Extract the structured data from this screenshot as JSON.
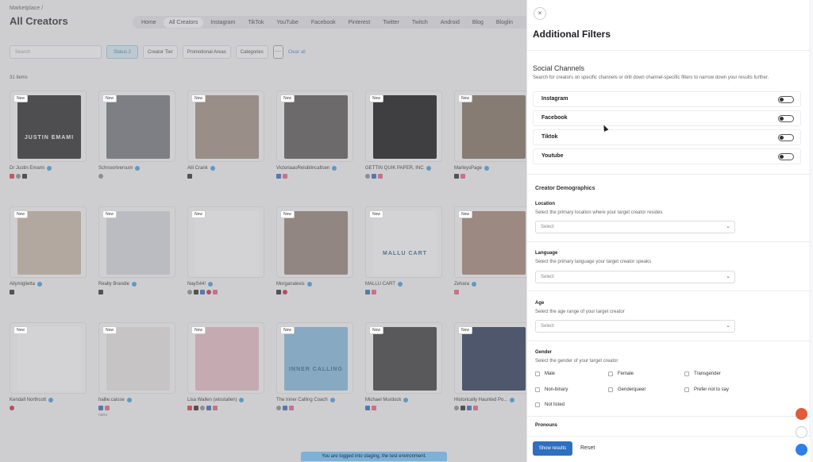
{
  "header": {
    "breadcrumb": "Marketplace /",
    "title": "All Creators",
    "nav": [
      "Home",
      "All Creators",
      "Instagram",
      "TikTok",
      "YouTube",
      "Facebook",
      "Pinterest",
      "Twitter",
      "Twitch",
      "Android",
      "Blog",
      "Bloglin"
    ]
  },
  "filters": {
    "search_placeholder": "Search",
    "status": "Status 2",
    "creator_tier": "Creator Tier",
    "promotional_areas": "Promotional Areas",
    "categories": "Categories",
    "more": "···",
    "clear_all": "Clear all",
    "items_count": "31 items"
  },
  "creators": [
    {
      "name": "Dr Justin Emami",
      "badge": "New",
      "socials": [
        "yt",
        "th",
        "tt"
      ],
      "thumb_text": "JUSTIN EMAMI"
    },
    {
      "name": "Schnoorlversum",
      "badge": "New",
      "socials": [
        "th"
      ]
    },
    {
      "name": "Alli Crank",
      "badge": "New",
      "socials": [
        "tt"
      ]
    },
    {
      "name": "VictoriaaoRelublincaltsen",
      "badge": "New",
      "socials": [
        "fb",
        "ig"
      ]
    },
    {
      "name": "GETTIN QUIK PAPER, INC",
      "badge": "New",
      "socials": [
        "th",
        "fb",
        "ig"
      ]
    },
    {
      "name": "MarleysPage",
      "badge": "New",
      "socials": [
        "tt",
        "ig"
      ]
    },
    {
      "name": "Allymiglietta",
      "badge": "New",
      "socials": [
        "tt"
      ]
    },
    {
      "name": "Really Brandie",
      "badge": "New",
      "socials": [
        "tt"
      ]
    },
    {
      "name": "NayS44!",
      "badge": "New",
      "socials": [
        "th",
        "tt",
        "fb",
        "pi",
        "ig"
      ]
    },
    {
      "name": "Morganalexis",
      "badge": "New",
      "socials": [
        "tt",
        "pi"
      ]
    },
    {
      "name": "MALLU CART",
      "badge": "New",
      "socials": [
        "fb",
        "ig"
      ],
      "thumb_text": "MALLU CART"
    },
    {
      "name": "Zehara",
      "badge": "New",
      "socials": [
        "ig"
      ]
    },
    {
      "name": "Kendall Northcott",
      "badge": "New",
      "socials": [
        "pi"
      ]
    },
    {
      "name": "hallie.caisse",
      "badge": "New",
      "socials": [
        "fb",
        "ig"
      ],
      "caption": "nanu"
    },
    {
      "name": "Lisa Wallen (wisstallen)",
      "badge": "New",
      "socials": [
        "yt",
        "tt",
        "th",
        "fb",
        "ig"
      ]
    },
    {
      "name": "The Inner Calling Coach",
      "badge": "New",
      "socials": [
        "th",
        "fb",
        "ig"
      ],
      "thumb_text": "INNER CALLING"
    },
    {
      "name": "Michael Murdock",
      "badge": "New",
      "socials": [
        "fb",
        "ig"
      ]
    },
    {
      "name": "Historically Haunted Po...",
      "badge": "New",
      "socials": [
        "th",
        "tt",
        "fb",
        "ig"
      ]
    }
  ],
  "panel": {
    "close": "×",
    "title": "Additional Filters",
    "social_channels": {
      "title": "Social Channels",
      "desc": "Search for creators on specific channels or drill down channel-specific filters to narrow down your results further.",
      "channels": [
        "Instagram",
        "Facebook",
        "Tiktok",
        "Youtube"
      ]
    },
    "demographics": {
      "title": "Creator Demographics",
      "location_label": "Location",
      "location_desc": "Select the primary location where your target creator resides",
      "language_label": "Language",
      "language_desc": "Select the primary language your target creator speaks",
      "age_label": "Age",
      "age_desc": "Select the age range of your target creator",
      "select_placeholder": "Select",
      "gender_label": "Gender",
      "gender_desc": "Select the gender of your target creator",
      "genders": [
        "Male",
        "Female",
        "Transgender",
        "Non-binary",
        "Genderqueer",
        "Prefer not to say",
        "Not listed"
      ],
      "pronouns_label": "Pronouns"
    },
    "show_results": "Show results",
    "reset": "Reset"
  },
  "staging_notice": "You are logged into staging, the test environment.",
  "colors": {
    "accent": "#2f6fbf",
    "verified": "#3a9be0"
  }
}
